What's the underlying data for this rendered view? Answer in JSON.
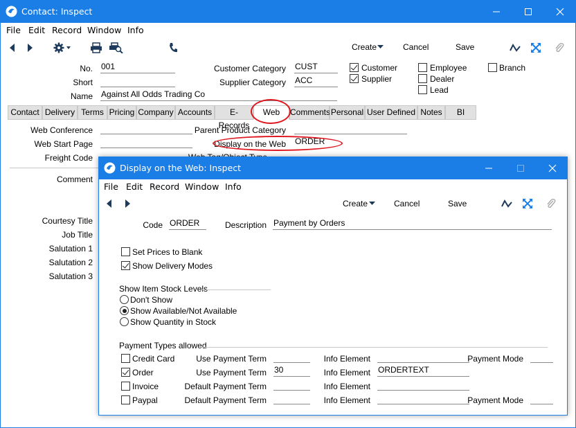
{
  "main_window": {
    "title": "Contact: Inspect",
    "menu": [
      "File",
      "Edit",
      "Record",
      "Window",
      "Info"
    ],
    "toolbar": {
      "create_label": "Create",
      "cancel_label": "Cancel",
      "save_label": "Save"
    },
    "header": {
      "no_label": "No.",
      "no_value": "001",
      "short_label": "Short",
      "short_value": "",
      "name_label": "Name",
      "name_value": "Against All Odds Trading Co",
      "customer_category_label": "Customer Category",
      "customer_category_value": "CUST",
      "supplier_category_label": "Supplier Category",
      "supplier_category_value": "ACC",
      "checkboxes": [
        {
          "label": "Customer",
          "checked": true
        },
        {
          "label": "Supplier",
          "checked": true
        },
        {
          "label": "Employee",
          "checked": false
        },
        {
          "label": "Dealer",
          "checked": false
        },
        {
          "label": "Lead",
          "checked": false
        },
        {
          "label": "Branch",
          "checked": false
        }
      ]
    },
    "tabs": [
      "Contact",
      "Delivery",
      "Terms",
      "Pricing",
      "Company",
      "Accounts",
      "E-Records",
      "Web",
      "Comments",
      "Personal",
      "User Defined",
      "Notes",
      "BI"
    ],
    "active_tab": "Web",
    "web_tab": {
      "web_conference_label": "Web Conference",
      "web_start_page_label": "Web Start Page",
      "freight_code_label": "Freight Code",
      "comment_label": "Comment",
      "parent_product_category_label": "Parent Product Category",
      "display_on_web_label": "Display on the Web",
      "display_on_web_value": "ORDER",
      "web_tag_label": "Web Tag/Object Type",
      "courtesy_title_label": "Courtesy Title",
      "job_title_label": "Job Title",
      "salutation1_label": "Salutation 1",
      "salutation2_label": "Salutation 2",
      "salutation3_label": "Salutation 3"
    }
  },
  "dialog": {
    "title": "Display on the Web: Inspect",
    "menu": [
      "File",
      "Edit",
      "Record",
      "Window",
      "Info"
    ],
    "toolbar": {
      "create_label": "Create",
      "cancel_label": "Cancel",
      "save_label": "Save"
    },
    "code_label": "Code",
    "code_value": "ORDER",
    "description_label": "Description",
    "description_value": "Payment by Orders",
    "set_prices_to_blank": {
      "label": "Set Prices to Blank",
      "checked": false
    },
    "show_delivery_modes": {
      "label": "Show Delivery Modes",
      "checked": true
    },
    "stock_levels_heading": "Show Item Stock Levels",
    "stock_levels_options": [
      {
        "label": "Don't Show",
        "selected": false
      },
      {
        "label": "Show Available/Not Available",
        "selected": true
      },
      {
        "label": "Show Quantity in Stock",
        "selected": false
      }
    ],
    "payment_types_heading": "Payment Types allowed",
    "payment_rows": [
      {
        "label": "Credit Card",
        "checked": false,
        "term_label": "Use Payment Term",
        "term_value": "",
        "info_label": "Info Element",
        "info_value": "",
        "mode_label": "Payment Mode",
        "mode_value": ""
      },
      {
        "label": "Order",
        "checked": true,
        "term_label": "Use Payment Term",
        "term_value": "30",
        "info_label": "Info Element",
        "info_value": "ORDERTEXT",
        "mode_label": "",
        "mode_value": ""
      },
      {
        "label": "Invoice",
        "checked": false,
        "term_label": "Default Payment Term",
        "term_value": "",
        "info_label": "Info Element",
        "info_value": "",
        "mode_label": "",
        "mode_value": ""
      },
      {
        "label": "Paypal",
        "checked": false,
        "term_label": "Default Payment Term",
        "term_value": "",
        "info_label": "Info Element",
        "info_value": "",
        "mode_label": "Payment Mode",
        "mode_value": ""
      }
    ]
  },
  "colors": {
    "titlebar": "#1a7ee6",
    "highlight": "#e0161e",
    "tab_bg": "#e1e1e1"
  }
}
